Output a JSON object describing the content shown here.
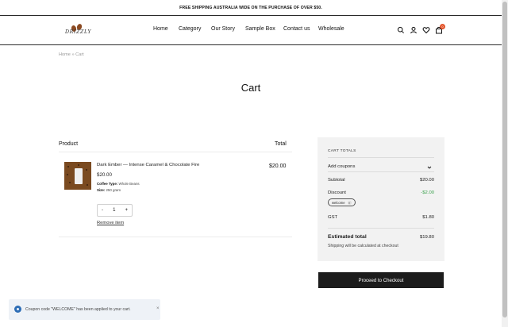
{
  "promo": {
    "text": "FREE SHIPPING AUSTRALIA WIDE ON THE PURCHASE OF OVER $50."
  },
  "logo": {
    "text": "DRIZZLY"
  },
  "nav": {
    "home": "Home",
    "category": "Category",
    "our_story": "Our Story",
    "sample_box": "Sample Box",
    "contact": "Contact us",
    "wholesale": "Wholesale"
  },
  "header": {
    "cart_count": "0",
    "icons": [
      "search-icon",
      "account-icon",
      "wishlist-icon",
      "cart-icon"
    ]
  },
  "breadcrumb": {
    "home": "Home",
    "sep": "»",
    "current": "Cart"
  },
  "page": {
    "title": "Cart"
  },
  "table": {
    "product_header": "Product",
    "total_header": "Total"
  },
  "item": {
    "name": "Dark Ember — Intense Caramel & Chocolate Fire",
    "price": "$20.00",
    "coffee_type_label": "Coffee Type:",
    "coffee_type": "Whole Beans",
    "size_label": "Size:",
    "size": "250 gram",
    "quantity": "1",
    "minus": "-",
    "plus": "+",
    "remove": "Remove item",
    "line_total": "$20.00"
  },
  "totals": {
    "title": "CART TOTALS",
    "add_coupons": "Add coupons",
    "subtotal_label": "Subtotal",
    "subtotal": "$20.00",
    "discount_label": "Discount",
    "discount": "-$2.00",
    "coupon_code": "welcome",
    "gst_label": "GST",
    "gst": "$1.80",
    "estimated_label": "Estimated total",
    "estimated": "$19.80",
    "shipping_note": "Shipping will be calculated at checkout"
  },
  "checkout": {
    "label": "Proceed to Checkout"
  },
  "toast": {
    "message": "Coupon code \"WELCOME\" has been applied to your cart.",
    "close": "×"
  },
  "colors": {
    "accent": "#1c1c1c",
    "discount": "#3aa14c",
    "badge": "#e4572e",
    "toast_icon": "#2d6db5",
    "thumb": "#7a4a20"
  }
}
